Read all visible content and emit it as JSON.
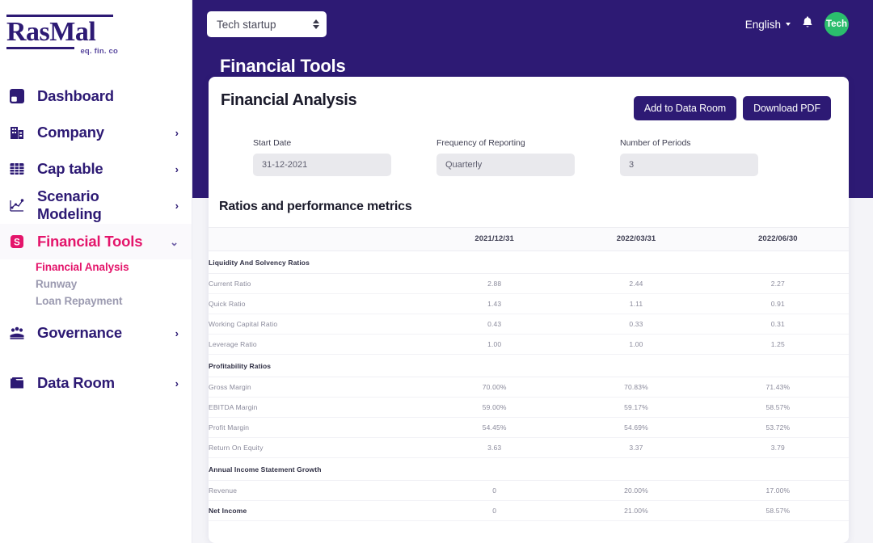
{
  "brand": {
    "name": "RasMal",
    "tagline": "eq. fin. co",
    "primary_color": "#2d1a74",
    "accent_color": "#e4156b",
    "avatar_color": "#2bbd6d"
  },
  "sidebar": {
    "items": [
      {
        "label": "Dashboard",
        "icon": "dashboard-icon",
        "has_chevron": false,
        "active": false
      },
      {
        "label": "Company",
        "icon": "building-icon",
        "has_chevron": true,
        "active": false
      },
      {
        "label": "Cap table",
        "icon": "grid-icon",
        "has_chevron": true,
        "active": false
      },
      {
        "label": "Scenario Modeling",
        "icon": "scatter-chart-icon",
        "has_chevron": true,
        "active": false
      },
      {
        "label": "Financial Tools",
        "icon": "dollar-badge-icon",
        "has_chevron": true,
        "active": true
      },
      {
        "label": "Governance",
        "icon": "governance-icon",
        "has_chevron": true,
        "active": false
      },
      {
        "label": "Data Room",
        "icon": "folder-icon",
        "has_chevron": true,
        "active": false
      }
    ],
    "subitems": [
      {
        "label": "Financial Analysis",
        "active": true
      },
      {
        "label": "Runway",
        "active": false
      },
      {
        "label": "Loan Repayment",
        "active": false
      }
    ]
  },
  "topbar": {
    "company_select_value": "Tech startup",
    "language": "English",
    "avatar_initials": "Tech",
    "page_title": "Financial Tools"
  },
  "card": {
    "title": "Financial Analysis",
    "add_to_data_room_label": "Add to Data Room",
    "download_pdf_label": "Download PDF",
    "fields": [
      {
        "label": "Start Date",
        "value": "31-12-2021"
      },
      {
        "label": "Frequency of Reporting",
        "value": "Quarterly"
      },
      {
        "label": "Number of Periods",
        "value": "3"
      }
    ],
    "section_title": "Ratios and performance metrics"
  },
  "table": {
    "name_header": "",
    "columns": [
      "2021/12/31",
      "2022/03/31",
      "2022/06/30"
    ],
    "sections": [
      {
        "title": "Liquidity And Solvency Ratios",
        "rows": [
          {
            "name": "Current Ratio",
            "values": [
              "2.88",
              "2.44",
              "2.27"
            ],
            "bold": false
          },
          {
            "name": "Quick Ratio",
            "values": [
              "1.43",
              "1.11",
              "0.91"
            ],
            "bold": false
          },
          {
            "name": "Working Capital Ratio",
            "values": [
              "0.43",
              "0.33",
              "0.31"
            ],
            "bold": false
          },
          {
            "name": "Leverage Ratio",
            "values": [
              "1.00",
              "1.00",
              "1.25"
            ],
            "bold": false
          }
        ]
      },
      {
        "title": "Profitability Ratios",
        "rows": [
          {
            "name": "Gross Margin",
            "values": [
              "70.00%",
              "70.83%",
              "71.43%"
            ],
            "bold": false
          },
          {
            "name": "EBITDA Margin",
            "values": [
              "59.00%",
              "59.17%",
              "58.57%"
            ],
            "bold": false
          },
          {
            "name": "Profit Margin",
            "values": [
              "54.45%",
              "54.69%",
              "53.72%"
            ],
            "bold": false
          },
          {
            "name": "Return On Equity",
            "values": [
              "3.63",
              "3.37",
              "3.79"
            ],
            "bold": false
          }
        ]
      },
      {
        "title": "Annual Income Statement Growth",
        "rows": [
          {
            "name": "Revenue",
            "values": [
              "0",
              "20.00%",
              "17.00%"
            ],
            "bold": false
          },
          {
            "name": "Net Income",
            "values": [
              "0",
              "21.00%",
              "58.57%"
            ],
            "bold": true
          }
        ]
      }
    ]
  }
}
